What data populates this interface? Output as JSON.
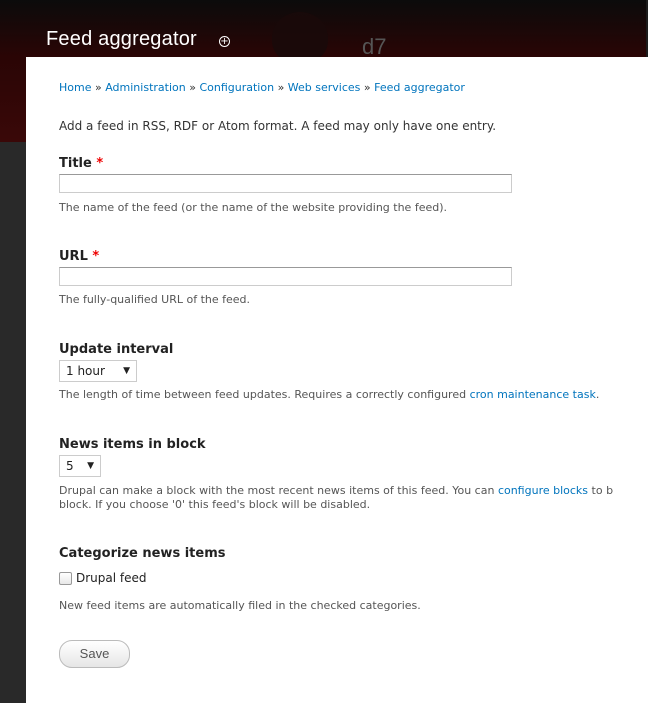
{
  "header": {
    "title": "Feed aggregator",
    "shortcut_glyph": "+",
    "logo_text": "d7"
  },
  "breadcrumb": {
    "items": [
      "Home",
      "Administration",
      "Configuration",
      "Web services",
      "Feed aggregator"
    ],
    "separator": "»"
  },
  "form": {
    "intro": "Add a feed in RSS, RDF or Atom format. A feed may only have one entry.",
    "required_marker": "*",
    "title": {
      "label": "Title",
      "value": "",
      "description": "The name of the feed (or the name of the website providing the feed)."
    },
    "url": {
      "label": "URL",
      "value": "",
      "description": "The fully-qualified URL of the feed."
    },
    "update_interval": {
      "label": "Update interval",
      "selected": "1 hour",
      "arrow": "▼",
      "description_before": "The length of time between feed updates. Requires a correctly configured ",
      "description_link": "cron maintenance task",
      "description_after": "."
    },
    "news_items": {
      "label": "News items in block",
      "selected": "5",
      "arrow": "▼",
      "description_before": "Drupal can make a block with the most recent news items of this feed. You can ",
      "description_link": "configure blocks",
      "description_after": " to b",
      "description_line2": "block. If you choose '0' this feed's block will be disabled."
    },
    "categorize": {
      "label": "Categorize news items",
      "checkbox_label": "Drupal feed",
      "checked": false,
      "description": "New feed items are automatically filed in the checked categories."
    },
    "save_label": "Save"
  },
  "colors": {
    "link": "#0074bd",
    "required": "#e00000",
    "header_bg": "#2a0505"
  }
}
